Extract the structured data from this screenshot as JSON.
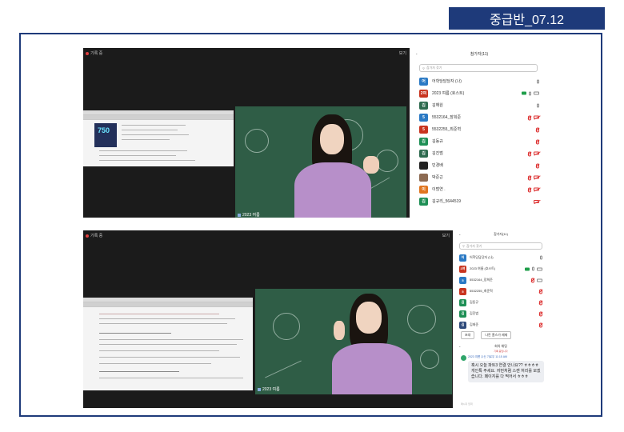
{
  "title": "중급반_07.12",
  "meeting": {
    "recording_label": "기록 중",
    "top_right_label": "보기",
    "speaker_name": "2023 여름"
  },
  "panel": {
    "title": "참가자(11)",
    "search_placeholder": "참가자 찾기",
    "participants": [
      {
        "initial": "어",
        "name": "어학당담당자 (나)",
        "color": "#2a79c4",
        "mic": "on",
        "cam": "none"
      },
      {
        "initial": "2여",
        "name": "2023 여름 (호스트)",
        "color": "#c8341f",
        "mic": "on",
        "cam": "on",
        "share": true
      },
      {
        "initial": "김",
        "name": "김해원",
        "color": "#2e6b4f",
        "mic": "on",
        "cam": "none"
      },
      {
        "initial": "5",
        "name": "5532164_장희준",
        "color": "#2a79c4",
        "mic": "off",
        "cam": "off"
      },
      {
        "initial": "5",
        "name": "5532255_최준혁",
        "color": "#c8341f",
        "mic": "off",
        "cam": "none"
      },
      {
        "initial": "김",
        "name": "김동규",
        "color": "#1e8f55",
        "mic": "off",
        "cam": "none"
      },
      {
        "initial": "김",
        "name": "김진범",
        "color": "#2e6b4f",
        "mic": "off",
        "cam": "off"
      },
      {
        "initial": "",
        "name": "민경배",
        "color": "#222222",
        "mic": "off",
        "cam": "none"
      },
      {
        "initial": "",
        "name": "박준근",
        "color": "#8c6a52",
        "mic": "off",
        "cam": "off"
      },
      {
        "initial": "이",
        "name": "이범연 .",
        "color": "#e0751f",
        "mic": "off",
        "cam": "off"
      },
      {
        "initial": "김",
        "name": "김규리_5644519",
        "color": "#1e8f55",
        "mic": "none",
        "cam": "off"
      }
    ]
  },
  "panel2": {
    "title": "참가자(11)",
    "search_placeholder": "참가자 찾기",
    "participants": [
      {
        "initial": "어",
        "name": "어학당담당자 (나)",
        "color": "#2a79c4",
        "mic": "on",
        "cam": "none"
      },
      {
        "initial": "2여",
        "name": "2023 여름 (호스트)",
        "color": "#c8341f",
        "mic": "on",
        "cam": "on",
        "share": true
      },
      {
        "initial": "5",
        "name": "5532164_장희준",
        "color": "#2a79c4",
        "mic": "off",
        "cam": "on"
      },
      {
        "initial": "5",
        "name": "5532255_최준혁",
        "color": "#c8341f",
        "mic": "off",
        "cam": "none"
      },
      {
        "initial": "김",
        "name": "김동규",
        "color": "#1e8f55",
        "mic": "off",
        "cam": "none"
      },
      {
        "initial": "김",
        "name": "김진범",
        "color": "#1e8f55",
        "mic": "off",
        "cam": "none"
      },
      {
        "initial": "김",
        "name": "김태준",
        "color": "#2e4a7a",
        "mic": "off",
        "cam": "none"
      }
    ],
    "invite_label": "초대",
    "lower_hands_label": "나란 홈스가 제제",
    "chat_title": "회의 채팅",
    "chat_subtitle": "기록 중입니다",
    "chat_sender": "2023 여름 수신 기로우",
    "chat_time": "11:15 AM",
    "chat_message": "혹시 오늘 파트3 연결 안나요?? ㅎㅎㅎㅎ 개인톡 주세요. 저번처럼 스캔 처리를 모겠습니다. 페이지를 다 찍어서 ㅎㅎㅎ",
    "chat_input_placeholder": "메시지 입력"
  },
  "slide_number": "750",
  "slide_number_2": "7"
}
